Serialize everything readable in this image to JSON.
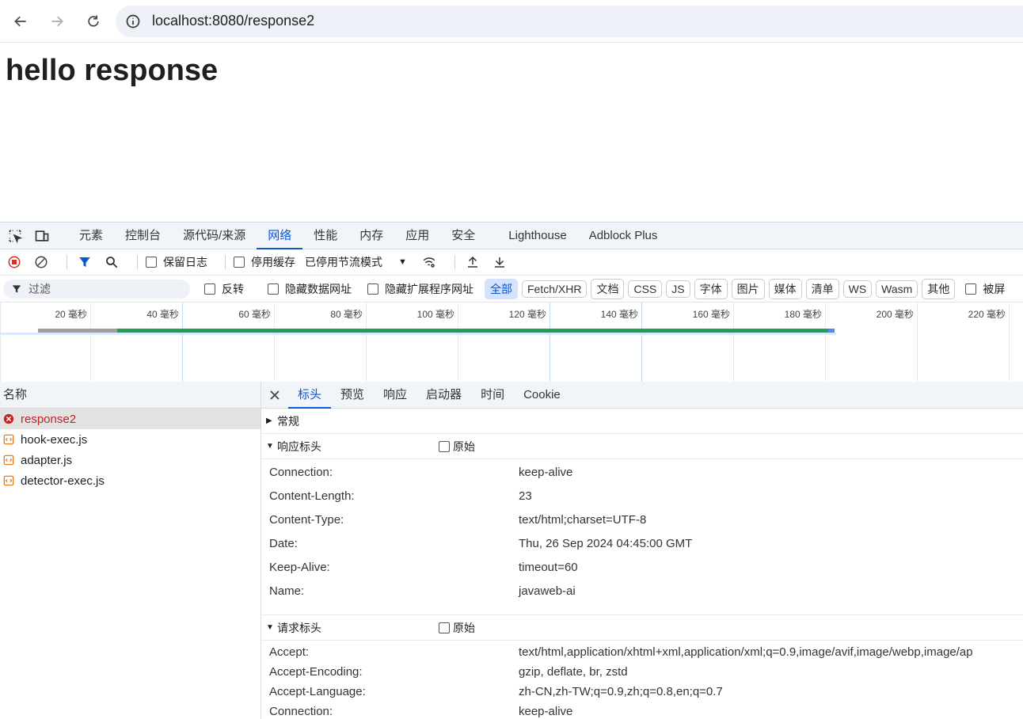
{
  "browser": {
    "url": "localhost:8080/response2"
  },
  "page": {
    "heading": "hello response"
  },
  "devtools": {
    "tabs": [
      "元素",
      "控制台",
      "源代码/来源",
      "网络",
      "性能",
      "内存",
      "应用",
      "安全",
      "Lighthouse",
      "Adblock Plus"
    ],
    "active_tab": "网络",
    "toolbar": {
      "preserve_log": "保留日志",
      "disable_cache": "停用缓存",
      "throttle": "已停用节流模式"
    },
    "filter": {
      "placeholder": "过滤",
      "invert": "反转",
      "hide_data_urls": "隐藏数据网址",
      "hide_ext_urls": "隐藏扩展程序网址",
      "types": [
        "全部",
        "Fetch/XHR",
        "文档",
        "CSS",
        "JS",
        "字体",
        "图片",
        "媒体",
        "清单",
        "WS",
        "Wasm",
        "其他"
      ],
      "blocked": "被屏"
    },
    "timeline_ticks": [
      "20 毫秒",
      "40 毫秒",
      "60 毫秒",
      "80 毫秒",
      "100 毫秒",
      "120 毫秒",
      "140 毫秒",
      "160 毫秒",
      "180 毫秒",
      "200 毫秒",
      "220 毫秒"
    ],
    "names_header": "名称",
    "requests": [
      {
        "name": "response2",
        "status": "error"
      },
      {
        "name": "hook-exec.js",
        "status": "script"
      },
      {
        "name": "adapter.js",
        "status": "script"
      },
      {
        "name": "detector-exec.js",
        "status": "script"
      }
    ],
    "detail_tabs": [
      "标头",
      "预览",
      "响应",
      "启动器",
      "时间",
      "Cookie"
    ],
    "sections": {
      "general": "常规",
      "response_headers": "响应标头",
      "request_headers": "请求标头",
      "raw": "原始"
    },
    "response_headers": [
      {
        "k": "Connection:",
        "v": "keep-alive"
      },
      {
        "k": "Content-Length:",
        "v": "23"
      },
      {
        "k": "Content-Type:",
        "v": "text/html;charset=UTF-8"
      },
      {
        "k": "Date:",
        "v": "Thu, 26 Sep 2024 04:45:00 GMT"
      },
      {
        "k": "Keep-Alive:",
        "v": "timeout=60"
      },
      {
        "k": "Name:",
        "v": "javaweb-ai"
      }
    ],
    "request_headers": [
      {
        "k": "Accept:",
        "v": "text/html,application/xhtml+xml,application/xml;q=0.9,image/avif,image/webp,image/ap"
      },
      {
        "k": "Accept-Encoding:",
        "v": "gzip, deflate, br, zstd"
      },
      {
        "k": "Accept-Language:",
        "v": "zh-CN,zh-TW;q=0.9,zh;q=0.8,en;q=0.7"
      },
      {
        "k": "Connection:",
        "v": "keep-alive"
      }
    ],
    "colors": {
      "accent": "#0b57d0",
      "error": "#c5221f",
      "waterfall_green": "#1e9e57"
    }
  }
}
